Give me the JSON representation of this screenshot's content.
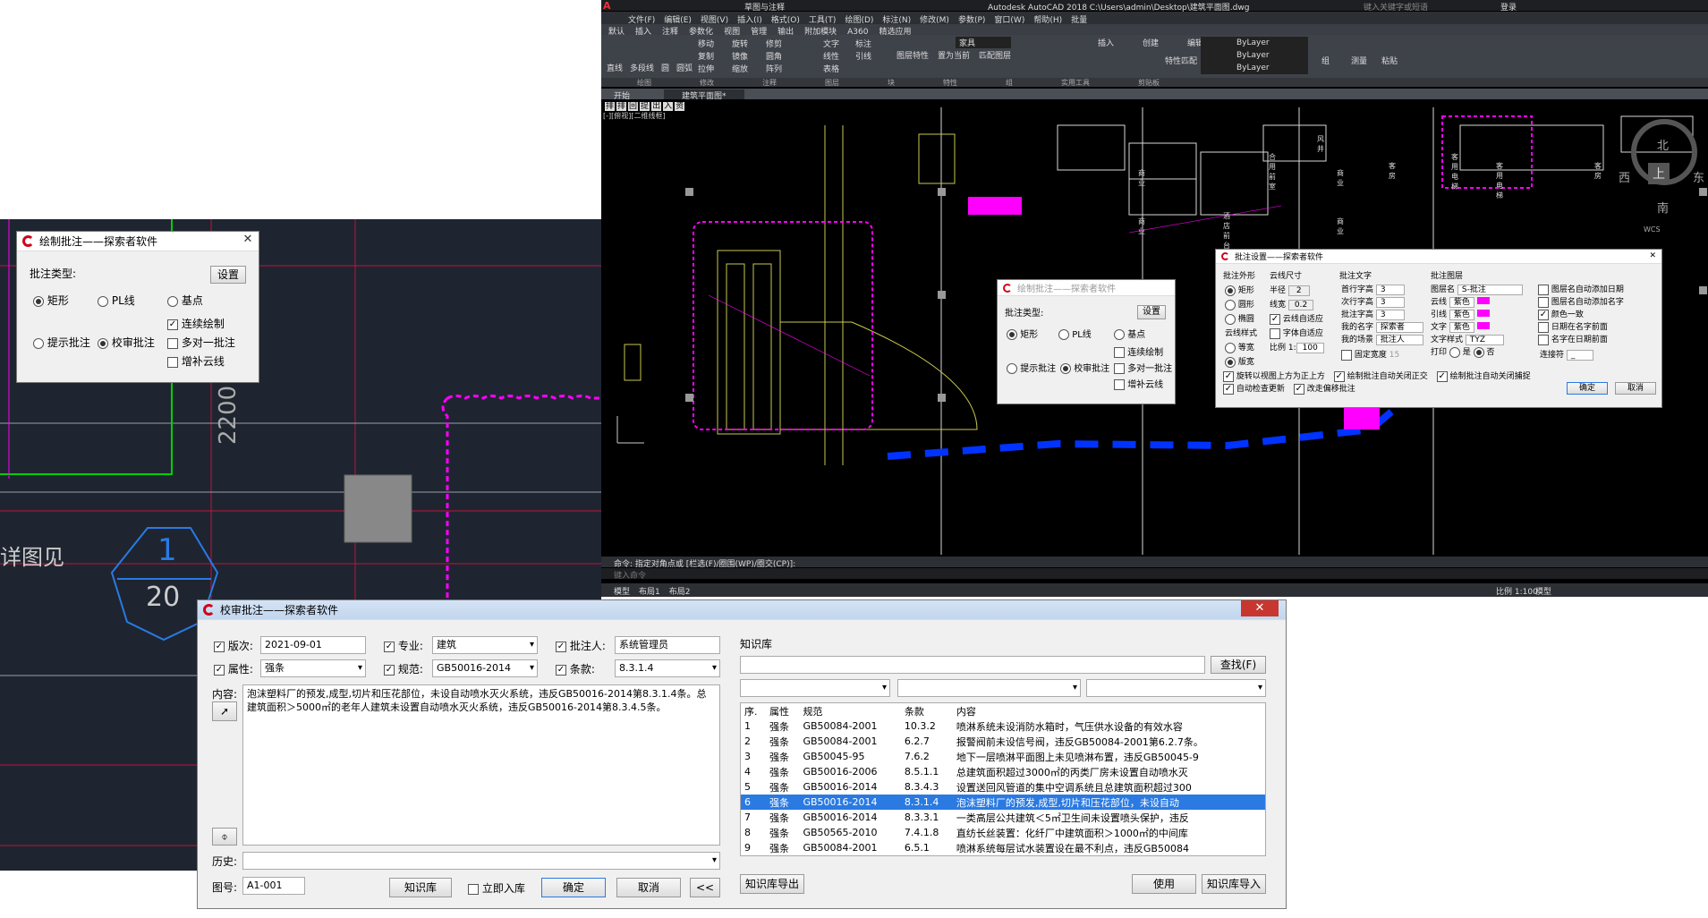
{
  "acad": {
    "title": "Autodesk AutoCAD 2018   C:\\Users\\admin\\Desktop\\建筑平面图.dwg",
    "search_placeholder": "键入关键字或短语",
    "login": "登录",
    "workspace": "草图与注释",
    "menus": [
      "文件(F)",
      "编辑(E)",
      "视图(V)",
      "插入(I)",
      "格式(O)",
      "工具(T)",
      "绘图(D)",
      "标注(N)",
      "修改(M)",
      "参数(P)",
      "窗口(W)",
      "帮助(H)",
      "批量"
    ],
    "ribbon_tabs": [
      "默认",
      "插入",
      "注释",
      "参数化",
      "视图",
      "管理",
      "输出",
      "附加模块",
      "A360",
      "精选应用"
    ],
    "ribbon_groups": [
      "绘图",
      "修改",
      "注释",
      "图层",
      "块",
      "特性",
      "组",
      "实用工具",
      "剪贴板"
    ],
    "draw_tools": [
      "直线",
      "多段线",
      "圆",
      "圆弧"
    ],
    "modify_tools": [
      "移动",
      "旋转",
      "修剪",
      "复制",
      "镜像",
      "圆角",
      "拉伸",
      "缩放",
      "阵列"
    ],
    "annot_tools": [
      "文字",
      "标注",
      "线性",
      "引线",
      "表格"
    ],
    "layer_tools": [
      "图层特性",
      "置为当前",
      "匹配图层"
    ],
    "layer_name": "家具",
    "block_tools": [
      "插入",
      "创建",
      "编辑",
      "编辑属性"
    ],
    "prop_label": "特性匹配",
    "bylayer": [
      "ByLayer",
      "ByLayer",
      "ByLayer"
    ],
    "group_label": "组",
    "util_label": "测量",
    "paste_label": "粘贴",
    "doc_tabs": [
      "开始",
      "建筑平面图*"
    ],
    "viewport_label": "[-][俯视][二维线框]",
    "compass": {
      "n": "北",
      "s": "南",
      "w": "西",
      "e": "东",
      "top": "上",
      "wcs": "WCS"
    },
    "cmd_line": "命令: 指定对角点或 [栏选(F)/圈围(WP)/圈交(CP)]:",
    "cmd_prompt": "键入命令",
    "layout_tabs": [
      "模型",
      "布局1",
      "布局2"
    ],
    "status_scale": "比例 1:100",
    "status_model": "模型",
    "room_labels": [
      "商业",
      "商业",
      "商业",
      "商业",
      "酒店前台",
      "客房",
      "合用前室",
      "风井",
      "客用电梯",
      "客用电梯",
      "客房"
    ],
    "tags": [
      "排",
      "排",
      "回",
      "提",
      "出",
      "入",
      "资"
    ]
  },
  "left_cad": {
    "dim": "2200",
    "text": "详图见",
    "circle_top": "1",
    "circle_bottom": "20"
  },
  "dlg_draw": {
    "title": "绘制批注——探索者软件",
    "type_label": "批注类型:",
    "settings": "设置",
    "opt_rect": "矩形",
    "opt_pl": "PL线",
    "opt_base": "基点",
    "opt_hint": "提示批注",
    "opt_check": "校审批注",
    "c_cont": "连续绘制",
    "c_multi": "多对一批注",
    "c_cloud": "增补云线"
  },
  "dlg_set": {
    "title": "批注设置——探索者软件",
    "g_shape": "批注外形",
    "g_cloud": "云线尺寸",
    "g_text": "批注文字",
    "g_layer": "批注图层",
    "shapes": [
      "矩形",
      "圆形",
      "椭圆"
    ],
    "cloud_style": "云线样式",
    "cloud_opts": [
      "等宽",
      "版宽"
    ],
    "radius": "半径",
    "radius_v": "2",
    "width": "线宽",
    "width_v": "0.2",
    "adapt": "云线自适应",
    "text_adapt": "字体自适应",
    "scale": "比例 1:",
    "scale_v": "100",
    "text_rows": [
      "首行字高",
      "次行字高",
      "批注字高",
      "我的名字",
      "我的场景"
    ],
    "text_vals": [
      "3",
      "3",
      "3",
      "探索者",
      "批注人"
    ],
    "fix_width": "固定宽度",
    "fix_v": "15",
    "layer_rows": [
      "图层名",
      "云线",
      "引线",
      "文字",
      "文字样式",
      "打印"
    ],
    "layer_name_v": "S-批注",
    "color_v": "紫色",
    "style_v": "TYZ",
    "print_yes": "是",
    "print_no": "否",
    "right_checks": [
      "图层名自动添加日期",
      "图层名自动添加名字",
      "颜色一致",
      "日期在名字前面",
      "名字在日期前面"
    ],
    "joiner": "连接符",
    "joiner_v": "_",
    "bottom_checks": [
      "旋转以视图上方为正上方",
      "绘制批注自动关闭正交",
      "绘制批注自动关闭捕捉",
      "自动检查更新",
      "改走偏移批注"
    ],
    "ok": "确定",
    "cancel": "取消"
  },
  "dlg_review": {
    "title": "校审批注——探索者软件",
    "edition_l": "版次:",
    "edition_v": "2021-09-01",
    "major_l": "专业:",
    "major_v": "建筑",
    "reviewer_l": "批注人:",
    "reviewer_v": "系统管理员",
    "attr_l": "属性:",
    "attr_v": "强条",
    "std_l": "规范:",
    "std_v": "GB50016-2014",
    "clause_l": "条款:",
    "clause_v": "8.3.1.4",
    "content_l": "内容:",
    "content_v": "泡沫塑料厂的预发,成型,切片和压花部位，未设自动喷水灭火系统，违反GB50016-2014第8.3.1.4条。总建筑面积＞5000㎡的老年人建筑未设置自动喷水灭火系统，违反GB50016-2014第8.3.4.5条。",
    "history_l": "历史:",
    "fig_l": "图号:",
    "fig_v": "A1-001",
    "kb_btn": "知识库",
    "immediate": "立即入库",
    "ok": "确定",
    "cancel": "取消",
    "collapse": "<<",
    "kb_title": "知识库",
    "search": "查找(F)",
    "kb_cols": [
      "序.",
      "属性",
      "规范",
      "条款",
      "内容"
    ],
    "kb_rows": [
      [
        "1",
        "强条",
        "GB50084-2001",
        "10.3.2",
        "喷淋系统未设消防水箱时，气压供水设备的有效水容"
      ],
      [
        "2",
        "强条",
        "GB50084-2001",
        "6.2.7",
        "报警阀前未设信号阀，违反GB50084-2001第6.2.7条。"
      ],
      [
        "3",
        "强条",
        "GB50045-95",
        "7.6.2",
        "地下一层喷淋平面图上未见喷淋布置，违反GB50045-9"
      ],
      [
        "4",
        "强条",
        "GB50016-2006",
        "8.5.1.1",
        "总建筑面积超过3000㎡的丙类厂房未设置自动喷水灭"
      ],
      [
        "5",
        "强条",
        "GB50016-2014",
        "8.3.4.3",
        "设置送回风管道的集中空调系统且总建筑面积超过300"
      ],
      [
        "6",
        "强条",
        "GB50016-2014",
        "8.3.1.4",
        "泡沫塑料厂的预发,成型,切片和压花部位，未设自动"
      ],
      [
        "7",
        "强条",
        "GB50016-2014",
        "8.3.3.1",
        "一类高层公共建筑＜5㎡卫生间未设置喷头保护，违反"
      ],
      [
        "8",
        "强条",
        "GB50565-2010",
        "7.4.1.8",
        "直纺长丝装置：化纤厂中建筑面积＞1000㎡的中间库"
      ],
      [
        "9",
        "强条",
        "GB50084-2001",
        "6.5.1",
        "喷淋系统每层试水装置设在最不利点，违反GB50084"
      ]
    ],
    "export": "知识库导出",
    "use": "使用",
    "import": "知识库导入"
  },
  "colors": {
    "magenta": "#ff00ff",
    "yellow": "#c8c850",
    "blue": "#0033ff",
    "select": "#2a7ae2"
  }
}
